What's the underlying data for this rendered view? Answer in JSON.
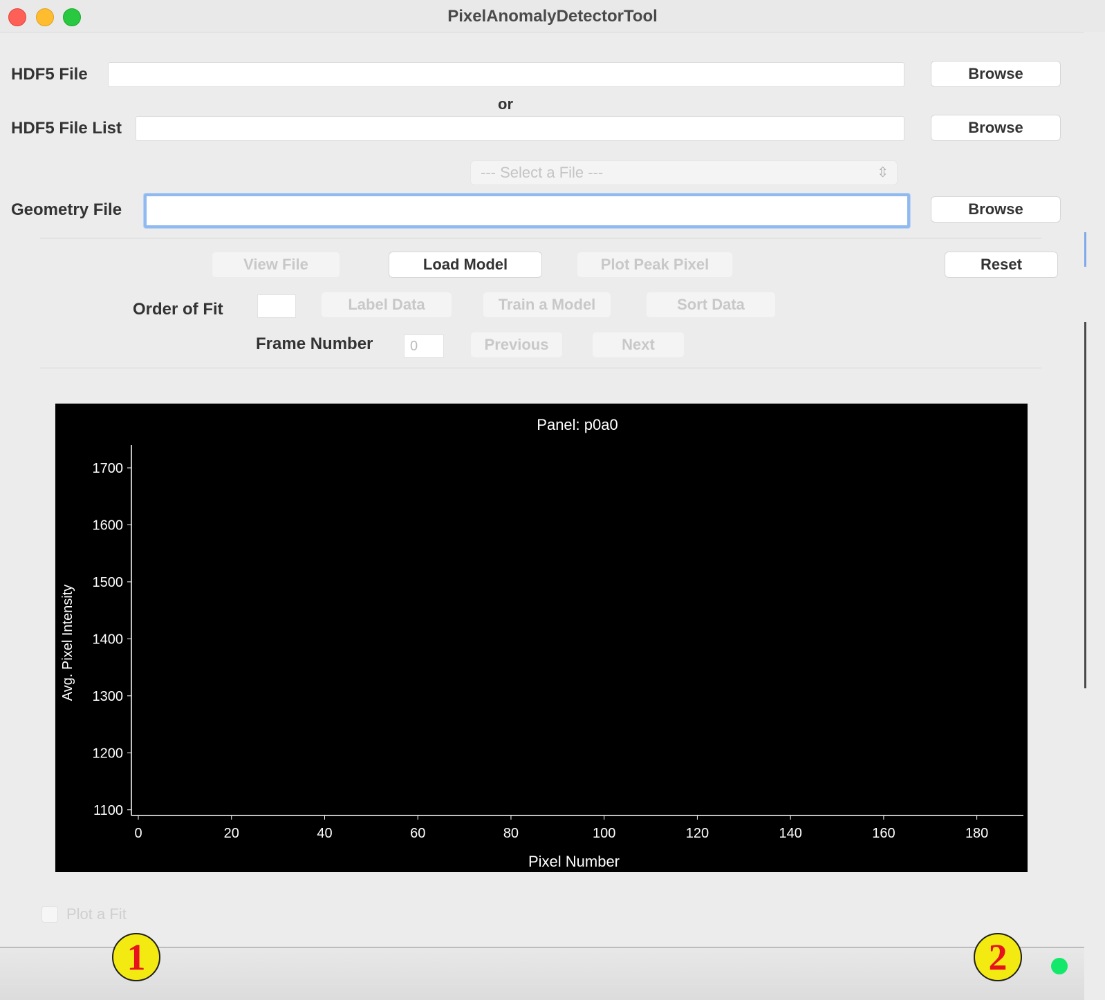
{
  "window": {
    "title": "PixelAnomalyDetectorTool"
  },
  "inputs": {
    "hdf5_file": {
      "label": "HDF5 File",
      "value": "",
      "browse": "Browse"
    },
    "or_text": "or",
    "hdf5_file_list": {
      "label": "HDF5 File List",
      "value": "",
      "browse": "Browse"
    },
    "file_select": {
      "value": "--- Select a File ---"
    },
    "geometry_file": {
      "label": "Geometry File",
      "value": "",
      "browse": "Browse"
    }
  },
  "actions": {
    "view_file": "View File",
    "load_model": "Load Model",
    "plot_peak_pixel": "Plot Peak Pixel",
    "reset": "Reset"
  },
  "fit": {
    "order_label": "Order of Fit",
    "order_value": "",
    "label_data": "Label Data",
    "train_model": "Train a Model",
    "sort_data": "Sort Data"
  },
  "frame": {
    "label": "Frame Number",
    "value": "0",
    "previous": "Previous",
    "next": "Next"
  },
  "chart_data": {
    "type": "line",
    "title": "Panel: p0a0",
    "xlabel": "Pixel Number",
    "ylabel": "Avg. Pixel Intensity",
    "x_ticks": [
      "0",
      "20",
      "40",
      "60",
      "80",
      "100",
      "120",
      "140",
      "160",
      "180"
    ],
    "y_ticks": [
      "1100",
      "1200",
      "1300",
      "1400",
      "1500",
      "1600",
      "1700"
    ],
    "xlim": [
      0,
      190
    ],
    "ylim": [
      1090,
      1740
    ],
    "series": [],
    "background": "#000000",
    "foreground": "#ffffff"
  },
  "options": {
    "plot_fit": "Plot a Fit"
  },
  "statusbar": {
    "marker_1": "1",
    "marker_2": "2"
  }
}
